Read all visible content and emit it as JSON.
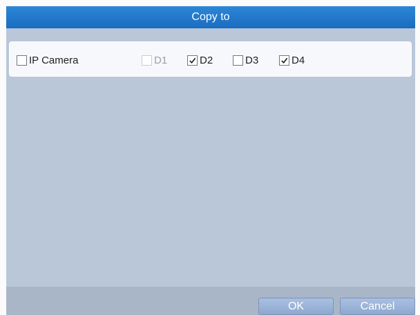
{
  "dialog": {
    "title": "Copy to",
    "ip_camera": {
      "label": "IP Camera",
      "checked": false
    },
    "channels": [
      {
        "label": "D1",
        "checked": false,
        "enabled": false
      },
      {
        "label": "D2",
        "checked": true,
        "enabled": true
      },
      {
        "label": "D3",
        "checked": false,
        "enabled": true
      },
      {
        "label": "D4",
        "checked": true,
        "enabled": true
      }
    ],
    "buttons": {
      "ok": "OK",
      "cancel": "Cancel"
    }
  }
}
